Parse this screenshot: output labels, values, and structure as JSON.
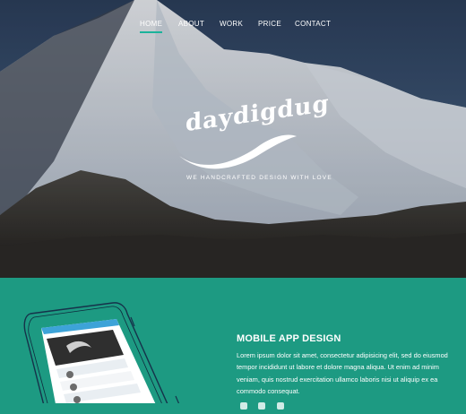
{
  "nav": {
    "items": [
      "HOME",
      "ABOUT",
      "WORK",
      "PRICE",
      "CONTACT"
    ],
    "active": "HOME"
  },
  "logo": {
    "text": "daydigdug",
    "tagline": "WE HANDCRAFTED DESIGN WITH LOVE"
  },
  "feature": {
    "title": "MOBILE APP DESIGN",
    "body": "Lorem ipsum dolor sit amet, consectetur adipisicing elit, sed do eiusmod tempor incididunt ut labore et dolore magna aliqua. Ut enim ad minim veniam, quis nostrud exercitation ullamco laboris nisi ut aliquip ex ea commodo consequat."
  },
  "colors": {
    "accent": "#1bb39a",
    "section_bg": "#1d9a82"
  },
  "icons": [
    "mountain-background-image",
    "phone-mockup",
    "social-icons"
  ]
}
